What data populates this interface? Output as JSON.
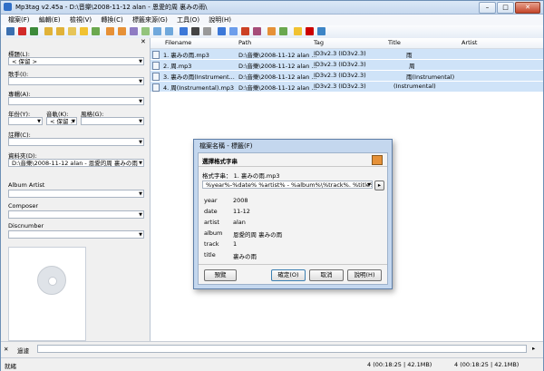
{
  "window": {
    "title": "Mp3tag v2.45a - D:\\音樂\\2008-11-12 alan - 恩愛的周 裏みの雨\\",
    "min": "–",
    "max": "□",
    "close": "✕"
  },
  "menu": [
    "檔案(F)",
    "編輯(E)",
    "檢視(V)",
    "轉換(C)",
    "標籤來源(G)",
    "工具(O)",
    "說明(H)"
  ],
  "left_panel": {
    "close": "✕",
    "fields": [
      {
        "label": "標題(L):",
        "value": "< 保留 >"
      },
      {
        "label": "歌手(I):",
        "value": ""
      },
      {
        "label": "專輯(A):",
        "value": ""
      },
      {
        "label": "年份(Y):",
        "value": ""
      },
      {
        "label": "音軌(K):",
        "value": "< 保留 >"
      },
      {
        "label": "風格(G):",
        "value": ""
      },
      {
        "label": "註釋(C):",
        "value": ""
      },
      {
        "label": "資料夾(D):",
        "value": "D:\\音樂\\2008-11-12 alan - 恩愛的周 裏みの雨"
      },
      {
        "label": "Album Artist",
        "value": ""
      },
      {
        "label": "Composer",
        "value": ""
      },
      {
        "label": "Discnumber",
        "value": ""
      }
    ]
  },
  "grid": {
    "columns": [
      "Filename",
      "Path",
      "Tag",
      "Title",
      "Artist"
    ],
    "rows": [
      {
        "filename": "1. 裏みの雨.mp3",
        "path": "D:\\音樂\\2008-11-12 alan ...",
        "tag": "ID3v2.3 (ID3v2.3)",
        "title": "雨"
      },
      {
        "filename": "2. 周.mp3",
        "path": "D:\\音樂\\2008-11-12 alan ...",
        "tag": "ID3v2.3 (ID3v2.3)",
        "title": "周"
      },
      {
        "filename": "3. 裏みの雨(Instrument...",
        "path": "D:\\音樂\\2008-11-12 alan ...",
        "tag": "ID3v2.3 (ID3v2.3)",
        "title": "雨(Instrumental)"
      },
      {
        "filename": "4. 周(Instrumental).mp3",
        "path": "D:\\音樂\\2008-11-12 alan ...",
        "tag": "ID3v2.3 (ID3v2.3)",
        "title": "(Instrumental)"
      }
    ]
  },
  "dialog": {
    "title": "檔案名稱 - 標籤(F)",
    "heading": "選擇格式字串",
    "format_label": "格式字串： 1. 裏みの雨.mp3",
    "format_value": "%year%-%date% %artist% - %album%\\%track%. %title%",
    "preview_keys": [
      "year",
      "date",
      "artist",
      "album",
      "track",
      "title"
    ],
    "preview_values": [
      "2008",
      "11-12",
      "alan",
      "恩愛的周 裏みの雨",
      "1",
      "裏みの雨"
    ],
    "buttons": {
      "preview": "預覽",
      "ok": "確定(O)",
      "cancel": "取消",
      "help": "說明(H)"
    }
  },
  "filter": {
    "label": "過濾",
    "value": ""
  },
  "status": {
    "left": "就緒",
    "selected": "4 (00:18:25 | 42.1MB)",
    "total": "4 (00:18:25 | 42.1MB)"
  }
}
